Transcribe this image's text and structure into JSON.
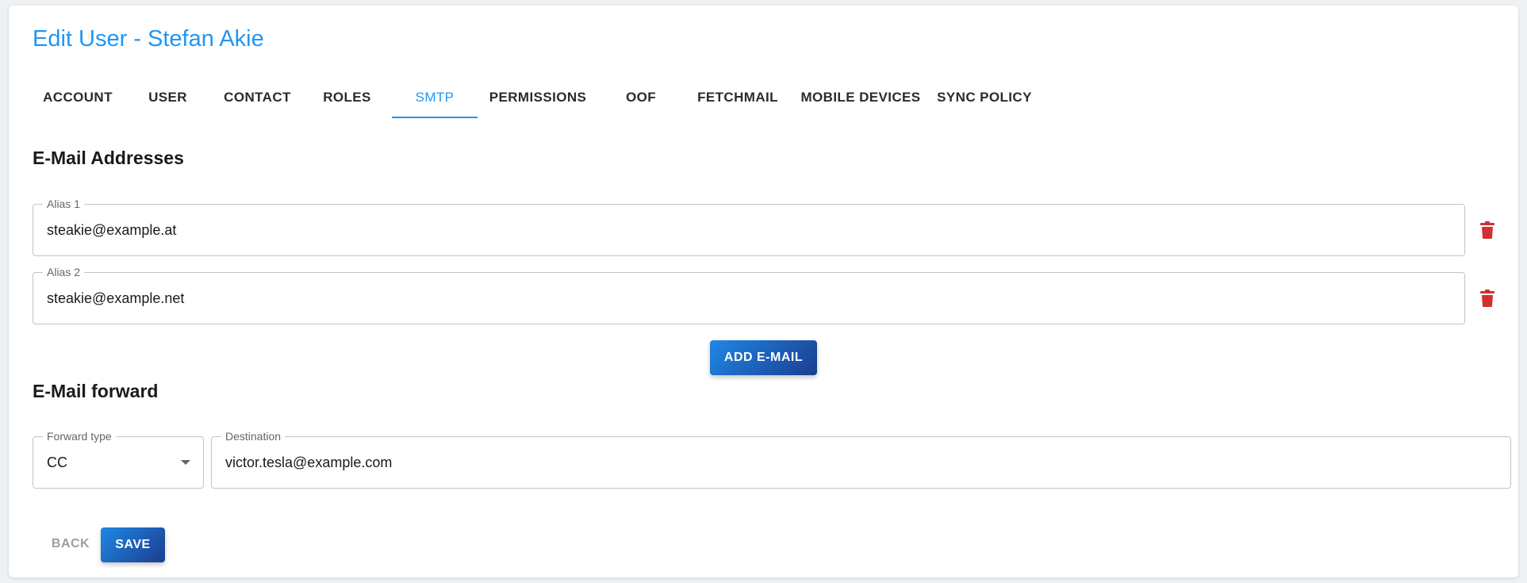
{
  "header": {
    "title": "Edit User - Stefan Akie"
  },
  "tabs": [
    {
      "label": "ACCOUNT",
      "active": false
    },
    {
      "label": "USER",
      "active": false
    },
    {
      "label": "CONTACT",
      "active": false
    },
    {
      "label": "ROLES",
      "active": false
    },
    {
      "label": "SMTP",
      "active": true
    },
    {
      "label": "PERMISSIONS",
      "active": false
    },
    {
      "label": "OOF",
      "active": false
    },
    {
      "label": "FETCHMAIL",
      "active": false
    },
    {
      "label": "MOBILE DEVICES",
      "active": false
    },
    {
      "label": "SYNC POLICY",
      "active": false
    }
  ],
  "email_addresses": {
    "title": "E-Mail Addresses",
    "aliases": [
      {
        "label": "Alias 1",
        "value": "steakie@example.at",
        "delete_icon": "trash-icon"
      },
      {
        "label": "Alias 2",
        "value": "steakie@example.net",
        "delete_icon": "trash-icon"
      }
    ],
    "add_label": "ADD E-MAIL"
  },
  "forward": {
    "title": "E-Mail forward",
    "type_label": "Forward type",
    "type_value": "CC",
    "type_icon": "caret-down-icon",
    "destination_label": "Destination",
    "destination_value": "victor.tesla@example.com"
  },
  "actions": {
    "back_label": "BACK",
    "save_label": "SAVE"
  },
  "colors": {
    "accent": "#2196f3",
    "delete": "#d32f2f",
    "button_gradient_start": "#1e88e5",
    "button_gradient_end": "#1c3d8f"
  }
}
